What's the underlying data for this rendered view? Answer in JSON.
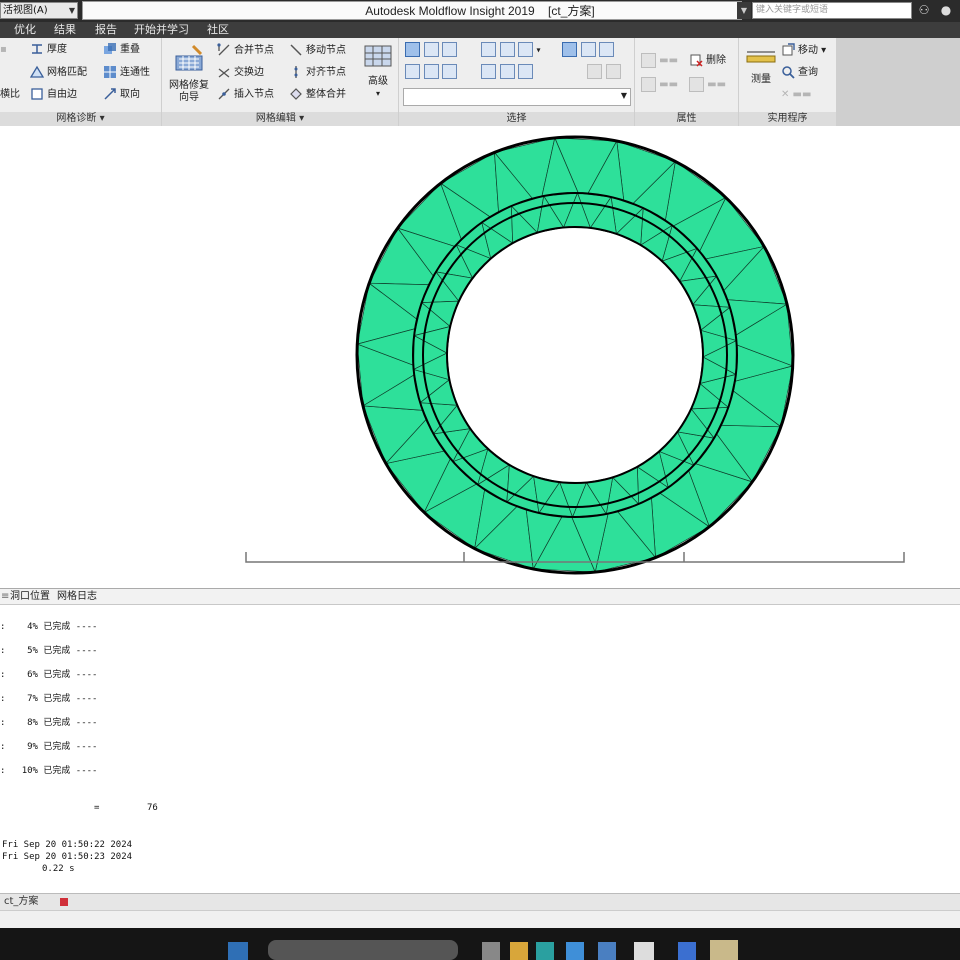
{
  "titlebar": {
    "workspace": "活视图(A)",
    "app_title": "Autodesk Moldflow Insight 2019",
    "doc_title": "[ct_方案]",
    "search_placeholder": "键入关键字或短语"
  },
  "menu": {
    "tabs": [
      "优化",
      "结果",
      "报告",
      "开始并学习",
      "社区"
    ]
  },
  "ribbon": {
    "mesh_diagnostics": {
      "label": "网格诊断",
      "items": {
        "thickness": "厚度",
        "mesh_match": "网格匹配",
        "free_edge": "自由边",
        "overlap": "重叠",
        "connectivity": "连通性",
        "orientation": "取向",
        "ratio_partial": "横比"
      }
    },
    "mesh_edit": {
      "label": "网格编辑",
      "repair_wizard": [
        "网格修复",
        "向导"
      ],
      "items": {
        "merge_nodes": "合并节点",
        "swap_edge": "交换边",
        "insert_node": "插入节点",
        "move_node": "移动节点",
        "align_nodes": "对齐节点",
        "global_merge": "整体合并"
      },
      "advanced": "高级"
    },
    "selection": {
      "label": "选择"
    },
    "properties": {
      "label": "属性",
      "delete": "删除"
    },
    "utilities": {
      "label": "实用程序",
      "measure": "测量",
      "move": "移动",
      "query": "查询"
    }
  },
  "log": {
    "tabs": [
      "洞口位置",
      "网格日志"
    ],
    "progress_lines": [
      {
        "prefix": ":",
        "pct": "4%",
        "text": "已完成 ----"
      },
      {
        "prefix": ":",
        "pct": "5%",
        "text": "已完成 ----"
      },
      {
        "prefix": ":",
        "pct": "6%",
        "text": "已完成 ----"
      },
      {
        "prefix": ":",
        "pct": "7%",
        "text": "已完成 ----"
      },
      {
        "prefix": ":",
        "pct": "8%",
        "text": "已完成 ----"
      },
      {
        "prefix": ":",
        "pct": "9%",
        "text": "已完成 ----"
      },
      {
        "prefix": ":",
        "pct": "10%",
        "text": "已完成 ----"
      }
    ],
    "count_marker": "=",
    "count_value": "76",
    "time_start": "Fri Sep 20 01:50:22 2024",
    "time_end": "Fri Sep 20 01:50:23 2024",
    "elapsed": "0.22 s"
  },
  "doc_tab": "ct_方案",
  "colors": {
    "mesh_fill": "#2ee09a",
    "mesh_edge": "#0f3f2c",
    "boundary": "#000000",
    "close_tab": "#d0303a"
  }
}
